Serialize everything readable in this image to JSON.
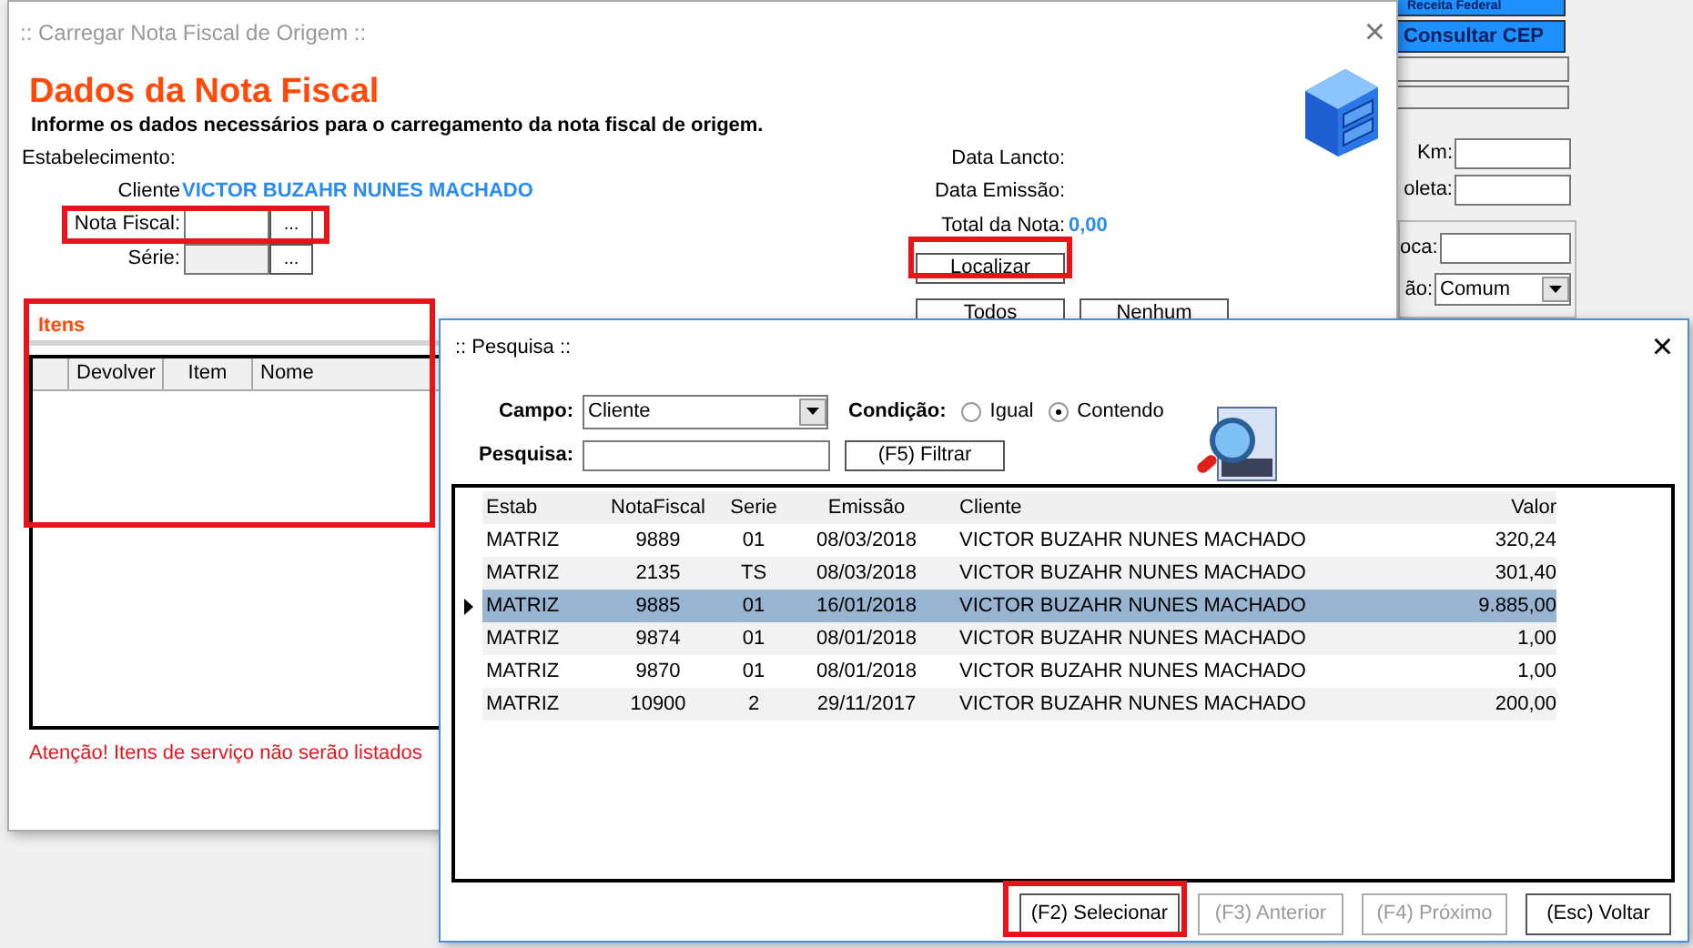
{
  "background_window": {
    "buttons": [
      {
        "label": "Receita Federal"
      },
      {
        "label": "Consultar CEP"
      }
    ],
    "fields": [
      {
        "label": "Km:"
      },
      {
        "label": "oleta:"
      }
    ],
    "group_fields": [
      {
        "label": "oca:",
        "kind": "text"
      },
      {
        "label": "ão:",
        "kind": "select",
        "value": "Comum"
      }
    ]
  },
  "main_dialog": {
    "title": ":: Carregar Nota Fiscal de Origem ::",
    "close": "×",
    "heading": "Dados da Nota Fiscal",
    "subtitle": "Informe os dados necessários para o carregamento da nota fiscal de origem.",
    "estabelecimento_label": "Estabelecimento:",
    "cliente_label": "Cliente",
    "cliente_value": "VICTOR BUZAHR NUNES MACHADO",
    "lookup_fields": [
      {
        "label": "Nota Fiscal:",
        "button": "...",
        "disabled": false,
        "highlighted": true
      },
      {
        "label": "Série:",
        "button": "...",
        "disabled": true,
        "highlighted": false
      }
    ],
    "info_labels": [
      "Data Lancto:",
      "Data Emissão:"
    ],
    "total_label": "Total da Nota:",
    "total_value": "0,00",
    "buttons": [
      {
        "label": "Localizar",
        "highlighted": true
      },
      {
        "label": "Todos",
        "highlighted": false
      },
      {
        "label": "Nenhum",
        "highlighted": false
      }
    ],
    "itens": {
      "title": "Itens",
      "highlighted": true,
      "columns": [
        "Devolver",
        "Item",
        "Nome"
      ]
    },
    "warning": "Atenção! Itens de serviço não serão listados"
  },
  "search_dialog": {
    "title": ":: Pesquisa ::",
    "close": "×",
    "campo_label": "Campo:",
    "campo_value": "Cliente",
    "condicao_label": "Condição:",
    "conditions": [
      {
        "label": "Igual",
        "selected": false
      },
      {
        "label": "Contendo",
        "selected": true
      }
    ],
    "pesquisa_label": "Pesquisa:",
    "filter_button": "(F5) Filtrar",
    "table": {
      "columns": [
        "Estab",
        "NotaFiscal",
        "Serie",
        "Emissão",
        "Cliente",
        "Valor"
      ],
      "rows": [
        {
          "cells": [
            "MATRIZ",
            "9889",
            "01",
            "08/03/2018",
            "VICTOR BUZAHR NUNES MACHADO",
            "320,24"
          ],
          "selected": false
        },
        {
          "cells": [
            "MATRIZ",
            "2135",
            "TS",
            "08/03/2018",
            "VICTOR BUZAHR NUNES MACHADO",
            "301,40"
          ],
          "selected": false
        },
        {
          "cells": [
            "MATRIZ",
            "9885",
            "01",
            "16/01/2018",
            "VICTOR BUZAHR NUNES MACHADO",
            "9.885,00"
          ],
          "selected": true
        },
        {
          "cells": [
            "MATRIZ",
            "9874",
            "01",
            "08/01/2018",
            "VICTOR BUZAHR NUNES MACHADO",
            "1,00"
          ],
          "selected": false
        },
        {
          "cells": [
            "MATRIZ",
            "9870",
            "01",
            "08/01/2018",
            "VICTOR BUZAHR NUNES MACHADO",
            "1,00"
          ],
          "selected": false
        },
        {
          "cells": [
            "MATRIZ",
            "10900",
            "2",
            "29/11/2017",
            "VICTOR BUZAHR NUNES MACHADO",
            "200,00"
          ],
          "selected": false
        }
      ]
    },
    "buttons": [
      {
        "label": "(F2) Selecionar",
        "disabled": false,
        "highlighted": true
      },
      {
        "label": "(F3) Anterior",
        "disabled": true,
        "highlighted": false
      },
      {
        "label": "(F4) Próximo",
        "disabled": true,
        "highlighted": false
      },
      {
        "label": "(Esc) Voltar",
        "disabled": false,
        "highlighted": false
      }
    ]
  }
}
